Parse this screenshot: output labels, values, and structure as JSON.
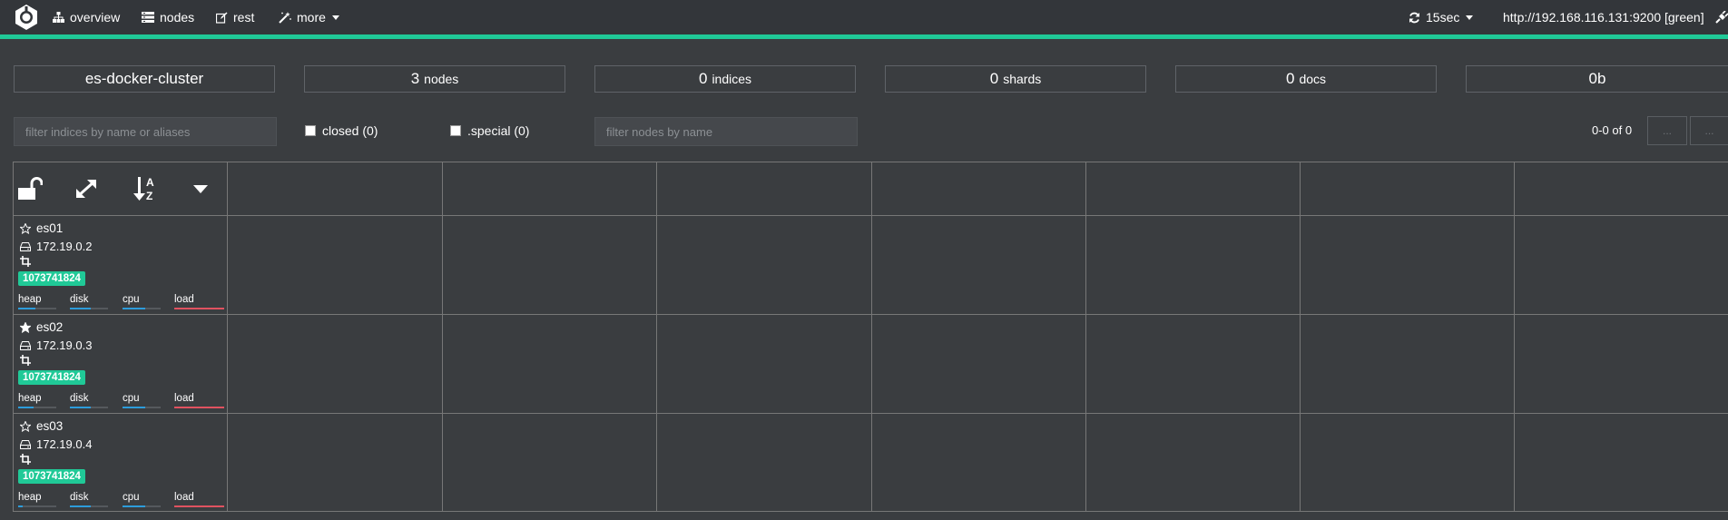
{
  "nav": {
    "overview": "overview",
    "nodes": "nodes",
    "rest": "rest",
    "more": "more",
    "refresh": "15sec",
    "connection": "http://192.168.116.131:9200 [green]"
  },
  "stats": {
    "cluster_name": "es-docker-cluster",
    "nodes_value": "3",
    "nodes_label": "nodes",
    "indices_value": "0",
    "indices_label": "indices",
    "shards_value": "0",
    "shards_label": "shards",
    "docs_value": "0",
    "docs_label": "docs",
    "size_value": "0b"
  },
  "filters": {
    "indices_placeholder": "filter indices by name or aliases",
    "closed_label": "closed (0)",
    "special_label": ".special (0)",
    "nodes_placeholder": "filter nodes by name",
    "pager_text": "0-0 of 0",
    "pager_prev": "...",
    "pager_next": "..."
  },
  "colors": {
    "accent": "#20c997",
    "metric_blue": "#2d9cdb",
    "metric_red": "#e05260"
  },
  "nodes": [
    {
      "name": "es01",
      "master": false,
      "ip": "172.19.0.2",
      "badge": "1073741824",
      "heap_label": "heap",
      "disk_label": "disk",
      "cpu_label": "cpu",
      "load_label": "load",
      "heap": 0.45,
      "disk": 0.55,
      "cpu": 0.6,
      "load": 1.0
    },
    {
      "name": "es02",
      "master": true,
      "ip": "172.19.0.3",
      "badge": "1073741824",
      "heap_label": "heap",
      "disk_label": "disk",
      "cpu_label": "cpu",
      "load_label": "load",
      "heap": 0.4,
      "disk": 0.55,
      "cpu": 0.6,
      "load": 1.0
    },
    {
      "name": "es03",
      "master": false,
      "ip": "172.19.0.4",
      "badge": "1073741824",
      "heap_label": "heap",
      "disk_label": "disk",
      "cpu_label": "cpu",
      "load_label": "load",
      "heap": 0.12,
      "disk": 0.55,
      "cpu": 0.6,
      "load": 1.0
    }
  ]
}
